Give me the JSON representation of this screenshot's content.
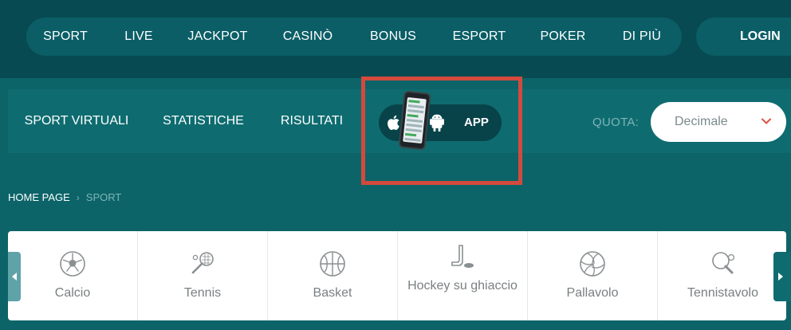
{
  "main_nav": {
    "items": [
      "SPORT",
      "LIVE",
      "JACKPOT",
      "CASINÒ",
      "BONUS",
      "ESPORT",
      "POKER",
      "DI PIÙ"
    ],
    "login_label": "LOGIN"
  },
  "sub_nav": {
    "items": [
      "SPORT VIRTUALI",
      "STATISTICHE",
      "RISULTATI"
    ],
    "app_label": "APP",
    "app_icons": [
      "apple-icon",
      "android-icon"
    ]
  },
  "quota": {
    "label": "QUOTA:",
    "selected": "Decimale"
  },
  "breadcrumb": {
    "home": "HOME PAGE",
    "separator": "›",
    "current": "SPORT"
  },
  "sports": [
    {
      "label": "Calcio",
      "icon": "soccer-ball-icon"
    },
    {
      "label": "Tennis",
      "icon": "tennis-racket-icon"
    },
    {
      "label": "Basket",
      "icon": "basketball-icon"
    },
    {
      "label": "Hockey su ghiaccio",
      "icon": "hockey-stick-icon"
    },
    {
      "label": "Pallavolo",
      "icon": "volleyball-icon"
    },
    {
      "label": "Tennistavolo",
      "icon": "ping-pong-icon"
    }
  ],
  "colors": {
    "top_bar": "#074a52",
    "page_bg": "#0c6468",
    "highlight": "#d34a3d",
    "chevron": "#e0503e"
  }
}
